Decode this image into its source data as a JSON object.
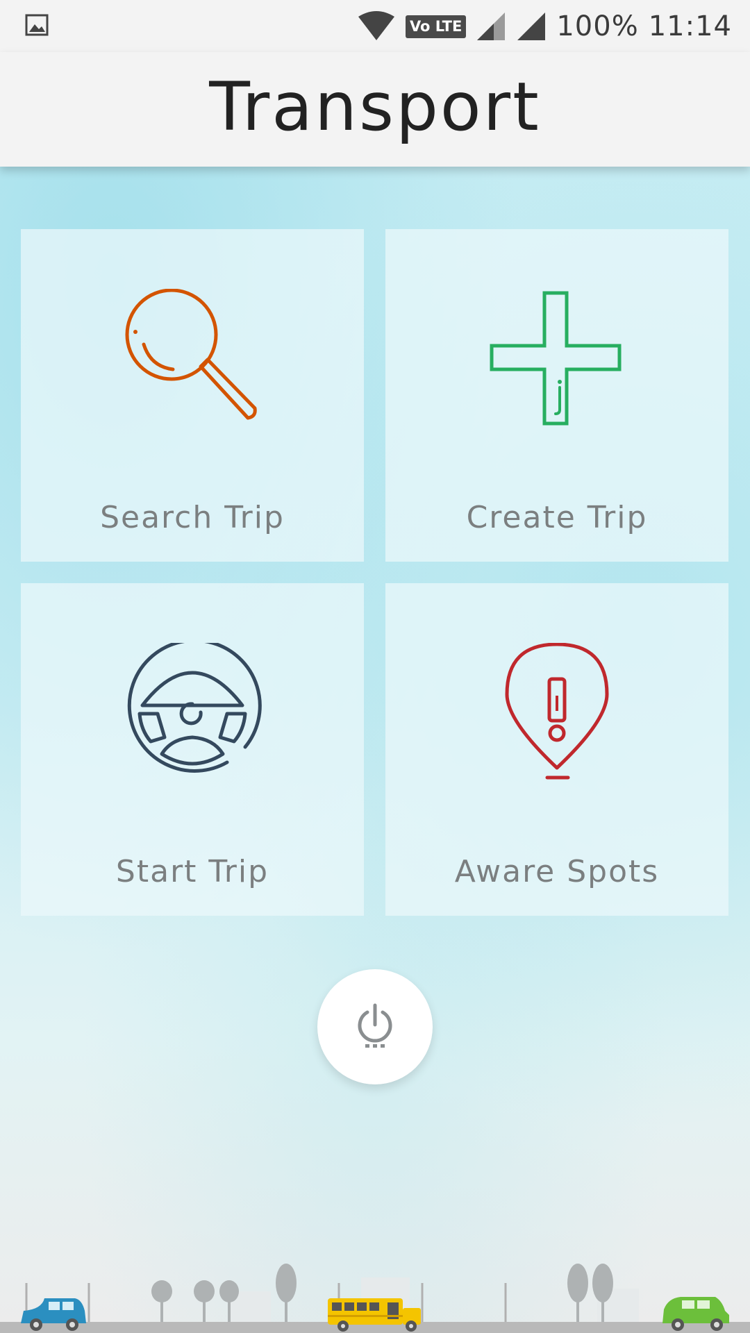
{
  "status_bar": {
    "network_badge": "Vo LTE",
    "battery": "100%",
    "time": "11:14",
    "icons": [
      "gallery-icon",
      "wifi-icon",
      "signal-icon",
      "signal-icon"
    ]
  },
  "app_bar": {
    "title": "Transport"
  },
  "tiles": [
    {
      "label": "Search Trip",
      "icon": "magnifier-icon",
      "color": "#d35400"
    },
    {
      "label": "Create Trip",
      "icon": "plus-icon",
      "color": "#27ae60"
    },
    {
      "label": "Start Trip",
      "icon": "steering-wheel-icon",
      "color": "#34495e"
    },
    {
      "label": "Aware Spots",
      "icon": "alert-pin-icon",
      "color": "#c0282d"
    }
  ],
  "power_button": {
    "icon": "power-icon"
  },
  "footer_illustration": {
    "icons": [
      "blue-car-icon",
      "school-bus-icon",
      "green-car-icon",
      "tree-icon",
      "street-lamp-icon"
    ],
    "colors": {
      "blue_car": "#2b8fc0",
      "bus": "#f4c400",
      "green_car": "#6cbf3b",
      "road": "#b9b9b9"
    }
  }
}
